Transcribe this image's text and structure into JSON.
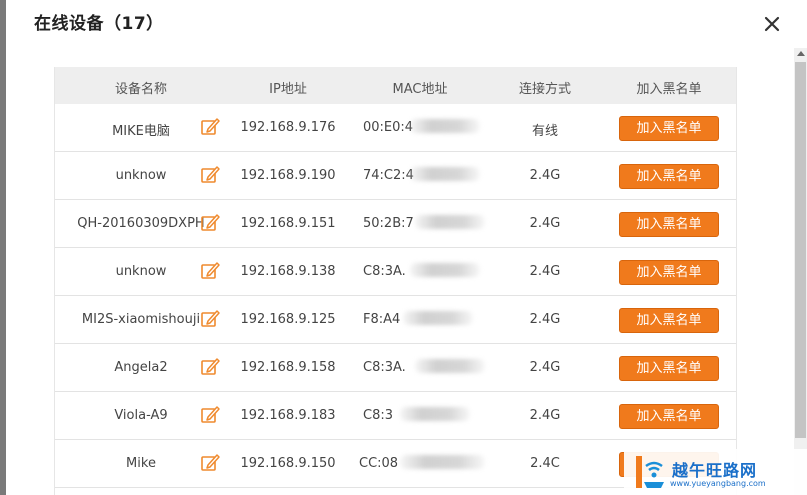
{
  "dialog": {
    "title": "在线设备（17）"
  },
  "table": {
    "headers": {
      "name": "设备名称",
      "ip": "IP地址",
      "mac": "MAC地址",
      "connection": "连接方式",
      "action": "加入黑名单"
    },
    "rows": [
      {
        "name": "MIKE电脑",
        "ip": "192.168.9.176",
        "mac": "00:E0:4",
        "connection": "有线",
        "action": "加入黑名单"
      },
      {
        "name": "unknow",
        "ip": "192.168.9.190",
        "mac": "74:C2:4",
        "connection": "2.4G",
        "action": "加入黑名单"
      },
      {
        "name": "QH-20160309DXPH",
        "ip": "192.168.9.151",
        "mac": "50:2B:7",
        "connection": "2.4G",
        "action": "加入黑名单"
      },
      {
        "name": "unknow",
        "ip": "192.168.9.138",
        "mac": "C8:3A.",
        "connection": "2.4G",
        "action": "加入黑名单"
      },
      {
        "name": "MI2S-xiaomishouji",
        "ip": "192.168.9.125",
        "mac": "F8:A4",
        "connection": "2.4G",
        "action": "加入黑名单"
      },
      {
        "name": "Angela2",
        "ip": "192.168.9.158",
        "mac": "C8:3A.",
        "connection": "2.4G",
        "action": "加入黑名单"
      },
      {
        "name": "Viola-A9",
        "ip": "192.168.9.183",
        "mac": "C8:3",
        "connection": "2.4G",
        "action": "加入黑名单"
      },
      {
        "name": "Mike",
        "ip": "192.168.9.150",
        "mac": "CC:08",
        "connection": "2.4C",
        "action": ""
      }
    ]
  },
  "watermark": {
    "text": "越午旺路网",
    "url": "www.yueyangbang.com"
  },
  "colors": {
    "accent": "#f07a1c",
    "header_bg": "#eeeeee"
  }
}
